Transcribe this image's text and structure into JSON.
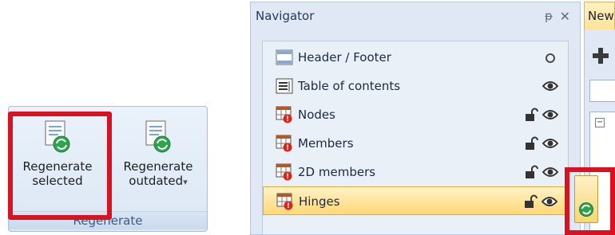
{
  "ribbon": {
    "buttons": [
      {
        "line1": "Regenerate",
        "line2": "selected"
      },
      {
        "line1": "Regenerate",
        "line2": "outdated",
        "dropdown": "▾"
      }
    ],
    "group_label": "Regenerate"
  },
  "navigator": {
    "title": "Navigator",
    "pin_symbol": "ᵽ",
    "close_symbol": "✕",
    "items": [
      {
        "label": "Header / Footer",
        "icon": "header-footer-icon",
        "state": "circle"
      },
      {
        "label": "Table of contents",
        "icon": "table-of-contents-icon",
        "state": "eye"
      },
      {
        "label": "Nodes",
        "icon": "table-warning-icon",
        "state": "lock-eye"
      },
      {
        "label": "Members",
        "icon": "table-warning-icon",
        "state": "lock-eye"
      },
      {
        "label": "2D members",
        "icon": "table-warning-icon",
        "state": "lock-eye"
      },
      {
        "label": "Hinges",
        "icon": "table-warning-icon",
        "state": "lock-eye",
        "selected": true
      }
    ]
  },
  "right_panel": {
    "tab_label": "New",
    "tree_expander": "−"
  },
  "colors": {
    "highlight_frame": "#d8121f",
    "selected_row": "#ffd877",
    "regenerate_arrow": "#2ea44f"
  }
}
